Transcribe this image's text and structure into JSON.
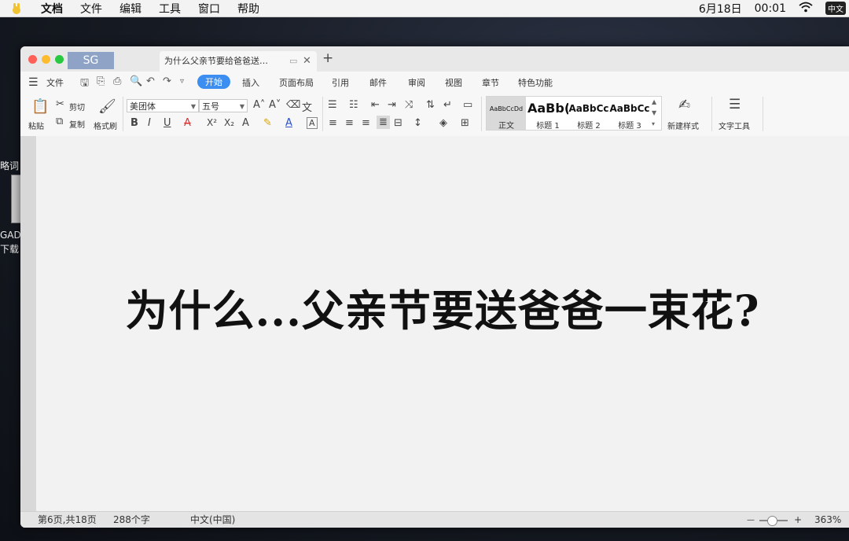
{
  "menubar": {
    "app_menu": "文档",
    "items": [
      "文件",
      "编辑",
      "工具",
      "窗口",
      "帮助"
    ],
    "date": "6月18日",
    "time": "00:01",
    "ime": "中文"
  },
  "desktop": {
    "peek_texts": [
      "略词",
      "GAD",
      "下载"
    ]
  },
  "window": {
    "home_label": "SG",
    "tab_title": "为什么父亲节要给爸爸送…",
    "new_tab_label": "+",
    "file_menu": "文件",
    "ribbon_tabs": [
      "开始",
      "插入",
      "页面布局",
      "引用",
      "邮件",
      "审阅",
      "视图",
      "章节",
      "特色功能"
    ],
    "active_tab": "开始"
  },
  "ribbon": {
    "paste": "粘贴",
    "cut": "剪切",
    "copy": "复制",
    "format_painter": "格式刷",
    "font_name": "美团体",
    "font_size": "五号",
    "styles": [
      {
        "sample": "AaBbCcDd",
        "name": "正文"
      },
      {
        "sample": "AaBb(",
        "name": "标题 1"
      },
      {
        "sample": "AaBbCc",
        "name": "标题 2"
      },
      {
        "sample": "AaBbCc",
        "name": "标题 3"
      }
    ],
    "new_style": "新建样式",
    "text_tools": "文字工具"
  },
  "document": {
    "heading": "为什么...父亲节要送爸爸一束花?"
  },
  "statusbar": {
    "page": "第6页,共18页",
    "word_count": "288个字",
    "language": "中文(中国)",
    "zoom_minus": "—",
    "zoom_plus": "+",
    "zoom": "363%"
  }
}
